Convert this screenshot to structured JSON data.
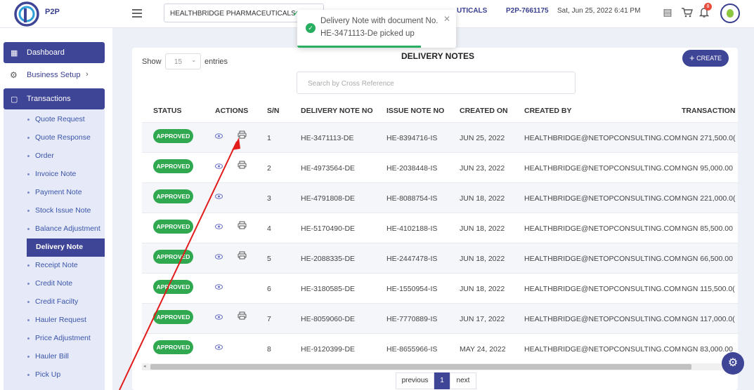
{
  "header": {
    "logo_text": "P2P",
    "company": "HEALTHBRIDGE PHARMACEUTICALS",
    "company_partial": "UTICALS",
    "session_id": "P2P-7661175",
    "datetime": "Sat, Jun 25, 2022 6:41 PM",
    "notification_count": "8"
  },
  "toast": {
    "line1": "Delivery Note with document No.",
    "line2": "HE-3471113-De picked up",
    "progress": 0.78
  },
  "sidebar": {
    "dashboard": "Dashboard",
    "business_setup": "Business Setup",
    "transactions": "Transactions",
    "items": [
      "Quote Request",
      "Quote Response",
      "Order",
      "Invoice Note",
      "Payment Note",
      "Stock Issue Note",
      "Balance Adjustment",
      "Delivery Note",
      "Receipt Note",
      "Credit Note",
      "Credit Facilty",
      "Hauler Request",
      "Price Adjustment",
      "Hauler Bill",
      "Pick Up"
    ],
    "active_index": 7
  },
  "main": {
    "show_label": "Show",
    "entries_value": "15",
    "entries_label": "entries",
    "title": "DELIVERY NOTES",
    "create_label": "CREATE",
    "search_placeholder": "Search by Cross Reference",
    "columns": [
      "STATUS",
      "ACTIONS",
      "S/N",
      "DELIVERY NOTE NO",
      "ISSUE NOTE NO",
      "CREATED ON",
      "CREATED BY",
      "TRANSACTION"
    ],
    "rows": [
      {
        "status": "APPROVED",
        "print": true,
        "sn": "1",
        "dn": "HE-3471113-DE",
        "in": "HE-8394716-IS",
        "created_on": "JUN 25, 2022",
        "created_by": "HEALTHBRIDGE@NETOPCONSULTING.COM",
        "txn": "NGN 271,500.0("
      },
      {
        "status": "APPROVED",
        "print": true,
        "sn": "2",
        "dn": "HE-4973564-DE",
        "in": "HE-2038448-IS",
        "created_on": "JUN 23, 2022",
        "created_by": "HEALTHBRIDGE@NETOPCONSULTING.COM",
        "txn": "NGN 95,000.00"
      },
      {
        "status": "APPROVED",
        "print": false,
        "sn": "3",
        "dn": "HE-4791808-DE",
        "in": "HE-8088754-IS",
        "created_on": "JUN 18, 2022",
        "created_by": "HEALTHBRIDGE@NETOPCONSULTING.COM",
        "txn": "NGN 221,000.0("
      },
      {
        "status": "APPROVED",
        "print": true,
        "sn": "4",
        "dn": "HE-5170490-DE",
        "in": "HE-4102188-IS",
        "created_on": "JUN 18, 2022",
        "created_by": "HEALTHBRIDGE@NETOPCONSULTING.COM",
        "txn": "NGN 85,500.00"
      },
      {
        "status": "APPROVED",
        "print": true,
        "sn": "5",
        "dn": "HE-2088335-DE",
        "in": "HE-2447478-IS",
        "created_on": "JUN 18, 2022",
        "created_by": "HEALTHBRIDGE@NETOPCONSULTING.COM",
        "txn": "NGN 66,500.00"
      },
      {
        "status": "APPROVED",
        "print": false,
        "sn": "6",
        "dn": "HE-3180585-DE",
        "in": "HE-1550954-IS",
        "created_on": "JUN 18, 2022",
        "created_by": "HEALTHBRIDGE@NETOPCONSULTING.COM",
        "txn": "NGN 115,500.0("
      },
      {
        "status": "APPROVED",
        "print": true,
        "sn": "7",
        "dn": "HE-8059060-DE",
        "in": "HE-7770889-IS",
        "created_on": "JUN 17, 2022",
        "created_by": "HEALTHBRIDGE@NETOPCONSULTING.COM",
        "txn": "NGN 117,000.0("
      },
      {
        "status": "APPROVED",
        "print": false,
        "sn": "8",
        "dn": "HE-9120399-DE",
        "in": "HE-8655966-IS",
        "created_on": "MAY 24, 2022",
        "created_by": "HEALTHBRIDGE@NETOPCONSULTING.COM",
        "txn": "NGN 83,000.00"
      }
    ],
    "pagination": {
      "previous": "previous",
      "current": "1",
      "next": "next"
    }
  },
  "colors": {
    "primary": "#3f4596",
    "success": "#2fa84f",
    "arrow": "#e21b1b"
  }
}
